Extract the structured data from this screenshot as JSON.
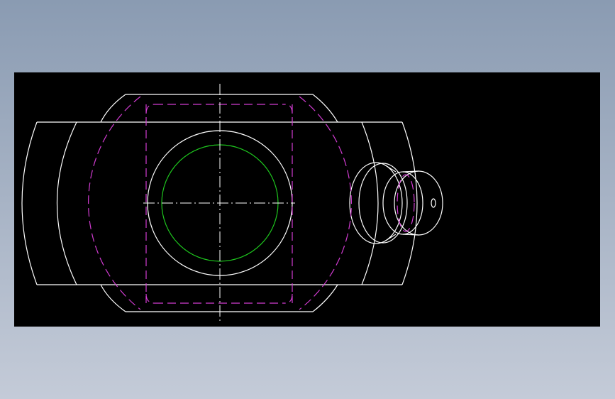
{
  "colors": {
    "background_top": "#8a9bb2",
    "background_bottom": "#c4cbd8",
    "viewport_bg": "#000000",
    "outline": "#ffffff",
    "hidden_line": "#d23cd2",
    "bore_circle": "#1ec81e",
    "centerline": "#ffffff"
  },
  "drawing": {
    "view": "front",
    "line_types": [
      "visible",
      "hidden",
      "center"
    ]
  }
}
